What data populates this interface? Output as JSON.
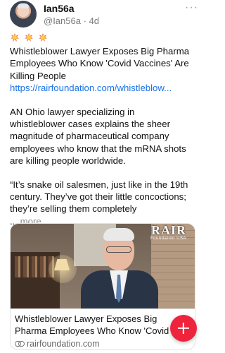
{
  "post": {
    "username": "Ian56a",
    "handle": "@Ian56a",
    "separator": "·",
    "age": "4d",
    "menu_icon": "more-horizontal-icon",
    "emojis": [
      "collision-icon",
      "collision-icon",
      "collision-icon"
    ],
    "headline_lines": [
      "Whistleblower Lawyer Exposes Big Pharma",
      "Employees Who Know 'Covid Vaccines' Are",
      "Killing People"
    ],
    "link_text": "https://rairfoundation.com/whistleblow...",
    "paragraph1_lines": [
      "AN Ohio lawyer specializing in",
      "whistleblower cases explains the sheer",
      "magnitude of pharmaceutical company",
      "employees who know that the mRNA shots",
      "are killing people worldwide."
    ],
    "paragraph2_lines": [
      "“It’s snake oil salesmen, just like in the 19th",
      "century. They’ve got their little concoctions;",
      "they’re selling them completely"
    ],
    "ellipsis": "...",
    "more_label": "more"
  },
  "card": {
    "logo_main": "RAIR",
    "logo_sub": "Foundation USA",
    "title": "Whistleblower Lawyer Exposes Big Pharma Employees Who Know 'Covid",
    "domain": "rairfoundation.com",
    "domain_icon": "link-icon"
  },
  "fab": {
    "icon": "plus-icon",
    "color": "#f0233c"
  },
  "colors": {
    "link": "#1a73e8",
    "muted": "#7a7a7a"
  }
}
